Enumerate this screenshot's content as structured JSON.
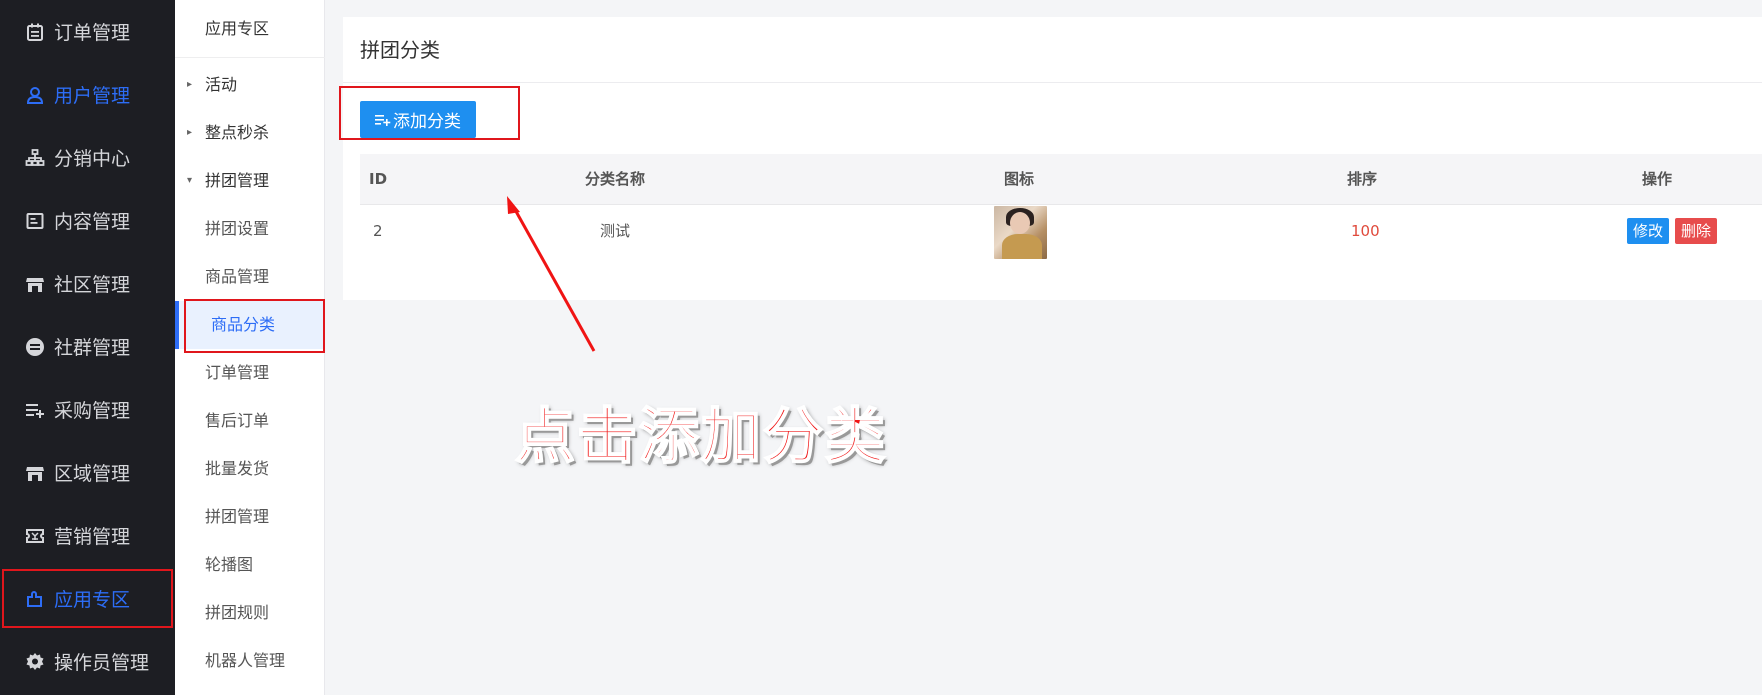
{
  "sidebar": {
    "items": [
      {
        "label": "订单管理",
        "icon": "calendar-icon"
      },
      {
        "label": "用户管理",
        "icon": "user-icon"
      },
      {
        "label": "分销中心",
        "icon": "org-chart-icon"
      },
      {
        "label": "内容管理",
        "icon": "document-icon"
      },
      {
        "label": "社区管理",
        "icon": "store-icon"
      },
      {
        "label": "社群管理",
        "icon": "minus-circle-icon"
      },
      {
        "label": "采购管理",
        "icon": "list-add-icon"
      },
      {
        "label": "区域管理",
        "icon": "store-icon"
      },
      {
        "label": "营销管理",
        "icon": "ticket-icon"
      },
      {
        "label": "应用专区",
        "icon": "puzzle-icon"
      },
      {
        "label": "操作员管理",
        "icon": "gear-icon"
      }
    ]
  },
  "subnav": {
    "title": "应用专区",
    "items": [
      {
        "label": "活动",
        "caret": "▸"
      },
      {
        "label": "整点秒杀",
        "caret": "▸"
      },
      {
        "label": "拼团管理",
        "caret": "▾"
      },
      {
        "label": "拼团设置"
      },
      {
        "label": "商品管理"
      },
      {
        "label": "商品分类"
      },
      {
        "label": "订单管理"
      },
      {
        "label": "售后订单"
      },
      {
        "label": "批量发货"
      },
      {
        "label": "拼团管理"
      },
      {
        "label": "轮播图"
      },
      {
        "label": "拼团规则"
      },
      {
        "label": "机器人管理"
      }
    ]
  },
  "main": {
    "title": "拼团分类",
    "add_button": "添加分类",
    "table": {
      "headers": [
        "ID",
        "分类名称",
        "图标",
        "排序",
        "操作"
      ],
      "rows": [
        {
          "id": "2",
          "name": "测试",
          "sort": "100",
          "edit": "修改",
          "delete": "删除"
        }
      ]
    }
  },
  "annotation": {
    "text": "点击添加分类"
  },
  "colors": {
    "accent": "#1e8ff0",
    "active_nav": "#2d6df6",
    "highlight": "#e0161c",
    "danger": "#e74c4c",
    "sidebar_bg": "#1d1e23"
  }
}
